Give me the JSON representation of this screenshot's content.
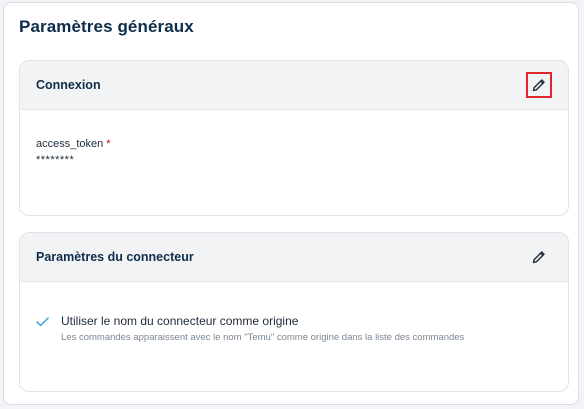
{
  "page": {
    "title": "Paramètres généraux"
  },
  "connection_card": {
    "title": "Connexion",
    "field": {
      "label": "access_token",
      "required_mark": "*",
      "value": "********"
    }
  },
  "connector_card": {
    "title": "Paramètres du connecteur",
    "option": {
      "checked": true,
      "label": "Utiliser le nom du connecteur comme origine",
      "description": "Les commandes apparaissent avec le nom \"Temu\" comme origine dans la liste des commandes"
    }
  },
  "icons": {
    "edit": "pencil-icon",
    "check": "checkmark-icon"
  },
  "colors": {
    "highlight": "#e0262a",
    "title": "#0f2d4a",
    "check": "#4aa8d8",
    "required": "#d0021b"
  }
}
